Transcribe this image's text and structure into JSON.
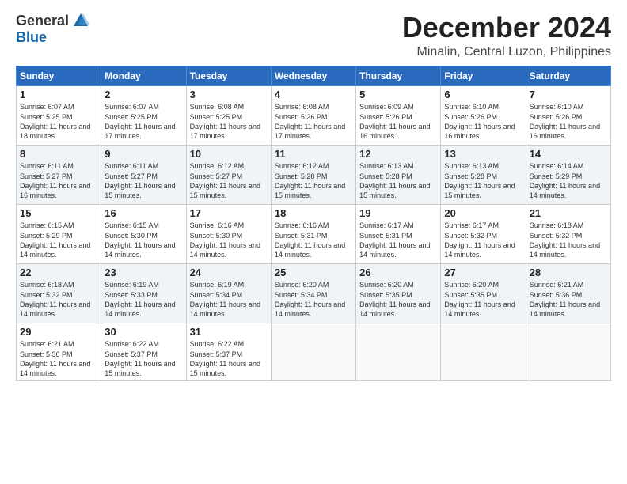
{
  "logo": {
    "general": "General",
    "blue": "Blue"
  },
  "title": "December 2024",
  "subtitle": "Minalin, Central Luzon, Philippines",
  "days_header": [
    "Sunday",
    "Monday",
    "Tuesday",
    "Wednesday",
    "Thursday",
    "Friday",
    "Saturday"
  ],
  "weeks": [
    [
      {
        "day": "1",
        "sunrise": "6:07 AM",
        "sunset": "5:25 PM",
        "daylight": "11 hours and 18 minutes."
      },
      {
        "day": "2",
        "sunrise": "6:07 AM",
        "sunset": "5:25 PM",
        "daylight": "11 hours and 17 minutes."
      },
      {
        "day": "3",
        "sunrise": "6:08 AM",
        "sunset": "5:25 PM",
        "daylight": "11 hours and 17 minutes."
      },
      {
        "day": "4",
        "sunrise": "6:08 AM",
        "sunset": "5:26 PM",
        "daylight": "11 hours and 17 minutes."
      },
      {
        "day": "5",
        "sunrise": "6:09 AM",
        "sunset": "5:26 PM",
        "daylight": "11 hours and 16 minutes."
      },
      {
        "day": "6",
        "sunrise": "6:10 AM",
        "sunset": "5:26 PM",
        "daylight": "11 hours and 16 minutes."
      },
      {
        "day": "7",
        "sunrise": "6:10 AM",
        "sunset": "5:26 PM",
        "daylight": "11 hours and 16 minutes."
      }
    ],
    [
      {
        "day": "8",
        "sunrise": "6:11 AM",
        "sunset": "5:27 PM",
        "daylight": "11 hours and 16 minutes."
      },
      {
        "day": "9",
        "sunrise": "6:11 AM",
        "sunset": "5:27 PM",
        "daylight": "11 hours and 15 minutes."
      },
      {
        "day": "10",
        "sunrise": "6:12 AM",
        "sunset": "5:27 PM",
        "daylight": "11 hours and 15 minutes."
      },
      {
        "day": "11",
        "sunrise": "6:12 AM",
        "sunset": "5:28 PM",
        "daylight": "11 hours and 15 minutes."
      },
      {
        "day": "12",
        "sunrise": "6:13 AM",
        "sunset": "5:28 PM",
        "daylight": "11 hours and 15 minutes."
      },
      {
        "day": "13",
        "sunrise": "6:13 AM",
        "sunset": "5:28 PM",
        "daylight": "11 hours and 15 minutes."
      },
      {
        "day": "14",
        "sunrise": "6:14 AM",
        "sunset": "5:29 PM",
        "daylight": "11 hours and 14 minutes."
      }
    ],
    [
      {
        "day": "15",
        "sunrise": "6:15 AM",
        "sunset": "5:29 PM",
        "daylight": "11 hours and 14 minutes."
      },
      {
        "day": "16",
        "sunrise": "6:15 AM",
        "sunset": "5:30 PM",
        "daylight": "11 hours and 14 minutes."
      },
      {
        "day": "17",
        "sunrise": "6:16 AM",
        "sunset": "5:30 PM",
        "daylight": "11 hours and 14 minutes."
      },
      {
        "day": "18",
        "sunrise": "6:16 AM",
        "sunset": "5:31 PM",
        "daylight": "11 hours and 14 minutes."
      },
      {
        "day": "19",
        "sunrise": "6:17 AM",
        "sunset": "5:31 PM",
        "daylight": "11 hours and 14 minutes."
      },
      {
        "day": "20",
        "sunrise": "6:17 AM",
        "sunset": "5:32 PM",
        "daylight": "11 hours and 14 minutes."
      },
      {
        "day": "21",
        "sunrise": "6:18 AM",
        "sunset": "5:32 PM",
        "daylight": "11 hours and 14 minutes."
      }
    ],
    [
      {
        "day": "22",
        "sunrise": "6:18 AM",
        "sunset": "5:32 PM",
        "daylight": "11 hours and 14 minutes."
      },
      {
        "day": "23",
        "sunrise": "6:19 AM",
        "sunset": "5:33 PM",
        "daylight": "11 hours and 14 minutes."
      },
      {
        "day": "24",
        "sunrise": "6:19 AM",
        "sunset": "5:34 PM",
        "daylight": "11 hours and 14 minutes."
      },
      {
        "day": "25",
        "sunrise": "6:20 AM",
        "sunset": "5:34 PM",
        "daylight": "11 hours and 14 minutes."
      },
      {
        "day": "26",
        "sunrise": "6:20 AM",
        "sunset": "5:35 PM",
        "daylight": "11 hours and 14 minutes."
      },
      {
        "day": "27",
        "sunrise": "6:20 AM",
        "sunset": "5:35 PM",
        "daylight": "11 hours and 14 minutes."
      },
      {
        "day": "28",
        "sunrise": "6:21 AM",
        "sunset": "5:36 PM",
        "daylight": "11 hours and 14 minutes."
      }
    ],
    [
      {
        "day": "29",
        "sunrise": "6:21 AM",
        "sunset": "5:36 PM",
        "daylight": "11 hours and 14 minutes."
      },
      {
        "day": "30",
        "sunrise": "6:22 AM",
        "sunset": "5:37 PM",
        "daylight": "11 hours and 15 minutes."
      },
      {
        "day": "31",
        "sunrise": "6:22 AM",
        "sunset": "5:37 PM",
        "daylight": "11 hours and 15 minutes."
      },
      null,
      null,
      null,
      null
    ]
  ],
  "labels": {
    "sunrise": "Sunrise:",
    "sunset": "Sunset:",
    "daylight": "Daylight:"
  }
}
